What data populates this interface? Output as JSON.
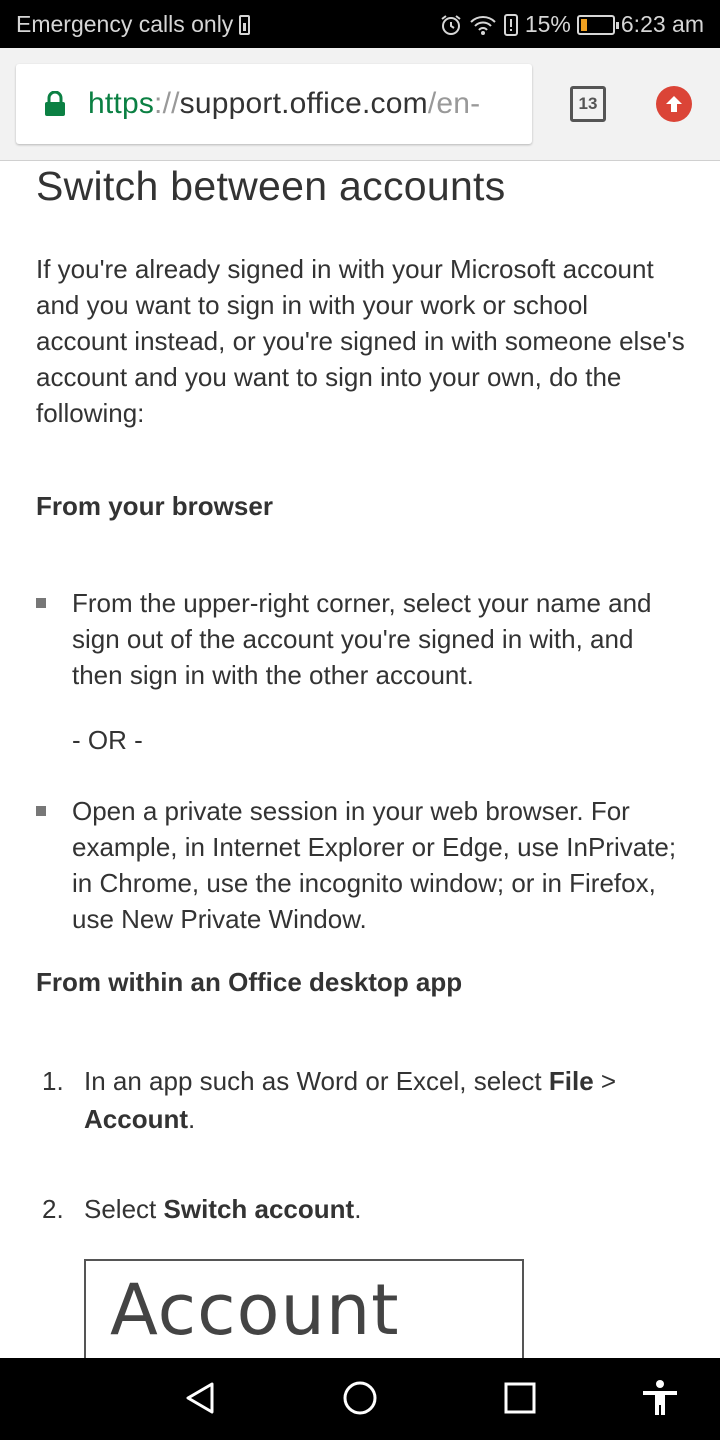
{
  "status_bar": {
    "carrier_text": "Emergency calls only",
    "battery_percent": "15%",
    "time": "6:23 am",
    "icons": [
      "sim-icon",
      "alarm-icon",
      "wifi-icon",
      "data-saver-icon",
      "battery-icon"
    ]
  },
  "browser": {
    "url_scheme": "https",
    "url_separator": "://",
    "url_host": "support.office.com",
    "url_path": "/en-",
    "tab_count": "13",
    "accent_secure": "#0b8043",
    "update_color": "#db4437"
  },
  "article": {
    "title": "Switch between accounts",
    "intro": "If you're already signed in with your Microsoft account and you want to sign in with your work or school account instead, or you're signed in with someone else's account and you want to sign into your own, do the following:",
    "section1_heading": "From your browser",
    "bullet1": "From the upper-right corner, select your name and sign out of the account you're signed in with, and then sign in with the other account.",
    "or_text": "- OR -",
    "bullet2": "Open a private session in your web browser. For example, in Internet Explorer or Edge, use InPrivate; in Chrome, use the incognito window; or in Firefox, use New Private Window.",
    "section2_heading": "From within an Office desktop app",
    "step1_num": "1.",
    "step1_prefix": "In an app such as Word or Excel, select ",
    "step1_bold1": "File",
    "step1_mid": " > ",
    "step1_bold2": "Account",
    "step1_suffix": ".",
    "step2_num": "2.",
    "step2_prefix": "Select ",
    "step2_bold": "Switch account",
    "step2_suffix": ".",
    "image_caption_text": "Account"
  },
  "nav_bar": {
    "buttons": [
      "back-icon",
      "home-icon",
      "recents-icon",
      "accessibility-icon"
    ]
  }
}
